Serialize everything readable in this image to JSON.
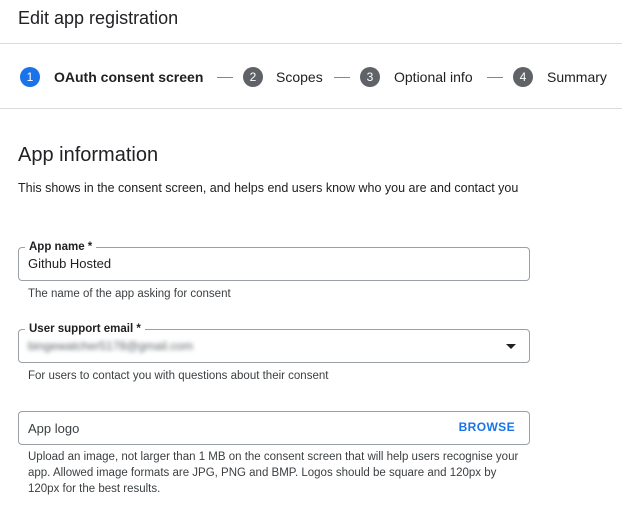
{
  "header": {
    "title": "Edit app registration"
  },
  "stepper": {
    "steps": [
      {
        "number": "1",
        "label": "OAuth consent screen",
        "active": true
      },
      {
        "number": "2",
        "label": "Scopes",
        "active": false
      },
      {
        "number": "3",
        "label": "Optional info",
        "active": false
      },
      {
        "number": "4",
        "label": "Summary",
        "active": false
      }
    ]
  },
  "section": {
    "title": "App information",
    "description": "This shows in the consent screen, and helps end users know who you are and contact you"
  },
  "fields": {
    "app_name": {
      "label": "App name *",
      "value": "Github Hosted",
      "hint": "The name of the app asking for consent"
    },
    "support_email": {
      "label": "User support email *",
      "value": "bingewatcher5178@gmail.com",
      "hint": "For users to contact you with questions about their consent"
    },
    "app_logo": {
      "placeholder": "App logo",
      "browse_label": "BROWSE",
      "hint": "Upload an image, not larger than 1 MB on the consent screen that will help users recognise your app. Allowed image formats are JPG, PNG and BMP. Logos should be square and 120px by 120px for the best results."
    }
  },
  "colors": {
    "accent": "#1a73e8",
    "step_inactive": "#5f6368",
    "border": "#9aa0a6",
    "divider": "#dadce0"
  }
}
